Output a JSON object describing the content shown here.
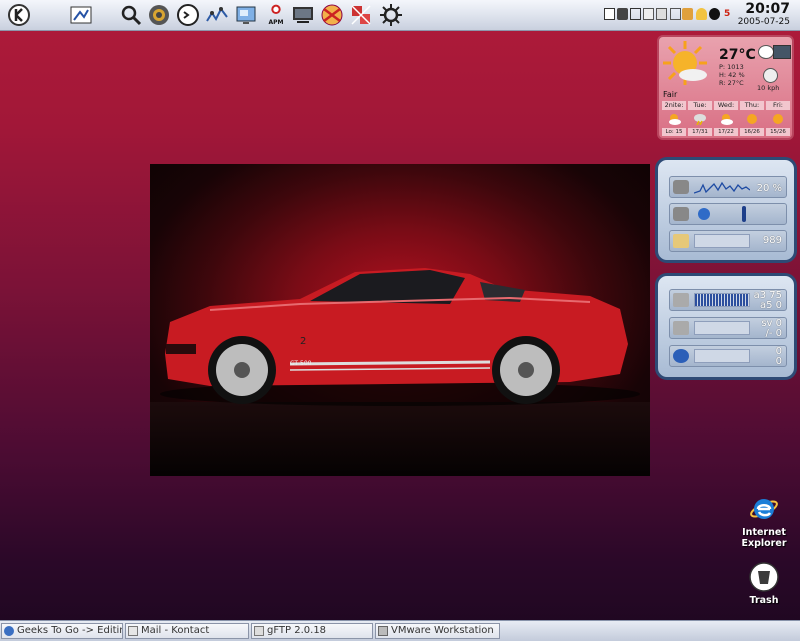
{
  "top_panel": {
    "launcher_icons": [
      "kmenu-icon",
      "kde-control-icon",
      "search-icon",
      "konqueror-icon",
      "terminal-icon",
      "network-graph-icon",
      "desktop-switcher-icon",
      "apm-icon",
      "monitor-icon",
      "ksysguard-icon",
      "media-icon",
      "settings-icon"
    ],
    "apm_label": "APM",
    "clock": {
      "time": "20:07",
      "date": "2005-07-25"
    }
  },
  "weather": {
    "temperature": "27°C",
    "pressure": "P: 1013",
    "humidity": "H: 42 %",
    "realfeel": "R: 27°C",
    "wind": "10 kph",
    "condition": "Fair",
    "forecast": [
      {
        "day": "2nite:",
        "temp": "Lo: 15"
      },
      {
        "day": "Tue:",
        "temp": "17/31"
      },
      {
        "day": "Wed:",
        "temp": "17/22"
      },
      {
        "day": "Thu:",
        "temp": "16/26"
      },
      {
        "day": "Fri:",
        "temp": "15/26"
      }
    ]
  },
  "monitor_top": {
    "cpu_value": "20 %",
    "disk_value": "989"
  },
  "monitor_bottom": {
    "net1_line1": "a3 75",
    "net1_line2": "a5 0",
    "net2_line1": "sv 0",
    "net2_line2": "/- 0",
    "net3_line1": "0",
    "net3_line2": "0"
  },
  "photo": {
    "badge": "GT 500",
    "door_number": "2"
  },
  "desktop_icons": [
    {
      "label_line1": "Internet",
      "label_line2": "Explorer"
    },
    {
      "label_line1": "Trash",
      "label_line2": ""
    }
  ],
  "taskbar": [
    {
      "label": "Geeks To Go -> Editing P",
      "icon": "browser-icon"
    },
    {
      "label": "Mail - Kontact",
      "icon": "mail-icon"
    },
    {
      "label": "gFTP 2.0.18",
      "icon": "ftp-icon"
    },
    {
      "label": "VMware Workstation",
      "icon": "vmware-icon"
    }
  ],
  "colors": {
    "panel": "#dfe4ee",
    "accent_red": "#b01b3a",
    "widget_border": "#2e4a75"
  }
}
